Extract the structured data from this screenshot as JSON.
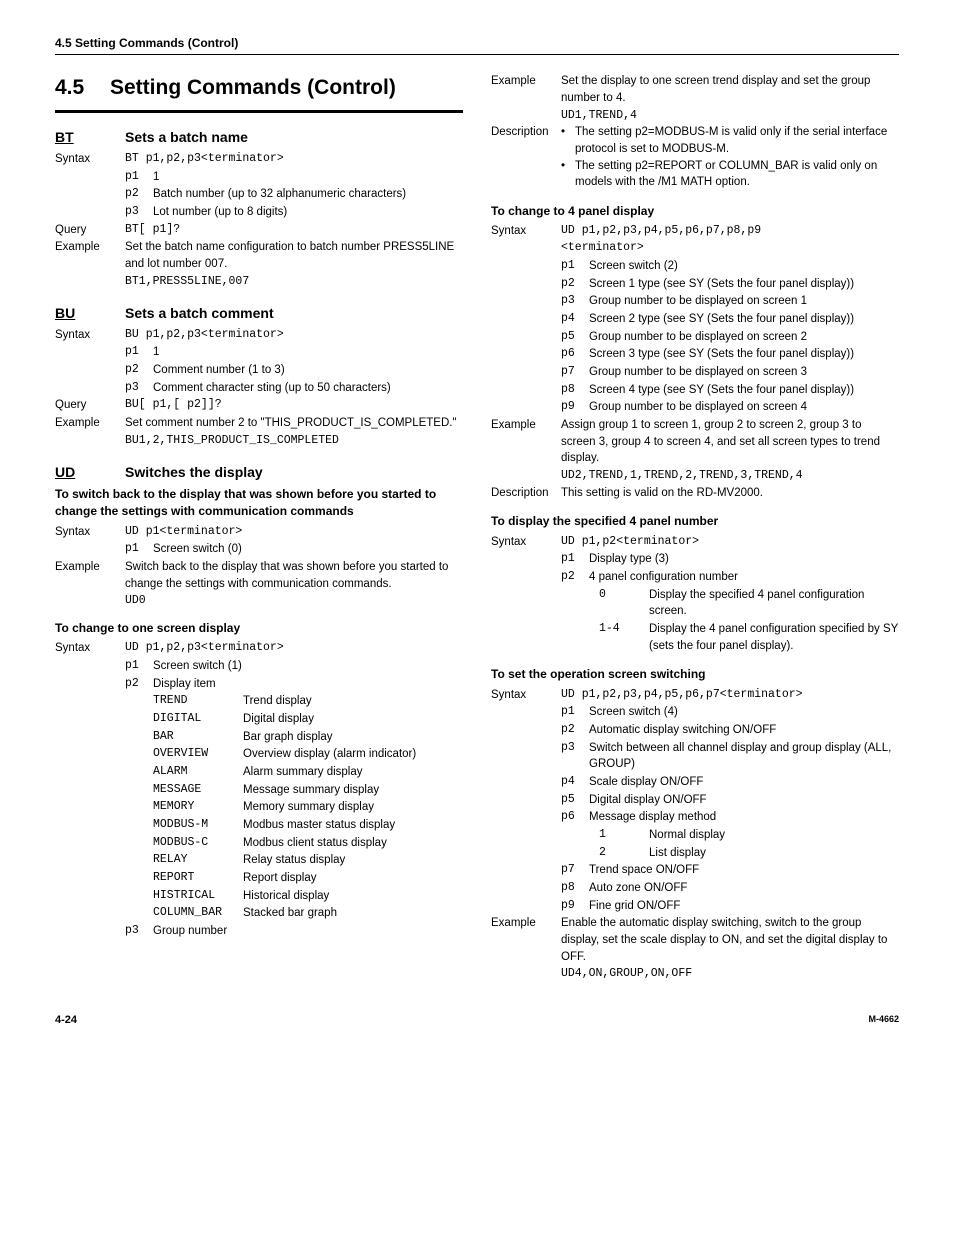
{
  "header": "4.5  Setting Commands (Control)",
  "section_number": "4.5",
  "section_title": "Setting Commands (Control)",
  "bt": {
    "code": "BT",
    "title": "Sets a batch name",
    "syntax_label": "Syntax",
    "syntax": "BT p1,p2,p3<terminator>",
    "p1": "1",
    "p2": "Batch number (up to 32 alphanumeric characters)",
    "p3": "Lot number (up to 8 digits)",
    "query_label": "Query",
    "query": "BT[ p1]?",
    "example_label": "Example",
    "example_text": "Set the batch name configuration to batch number PRESS5LINE and lot number 007.",
    "example_code": "BT1,PRESS5LINE,007"
  },
  "bu": {
    "code": "BU",
    "title": "Sets a batch comment",
    "syntax_label": "Syntax",
    "syntax": "BU p1,p2,p3<terminator>",
    "p1": "1",
    "p2": "Comment number (1 to 3)",
    "p3": "Comment character sting (up to 50 characters)",
    "query_label": "Query",
    "query": "BU[ p1,[ p2]]?",
    "example_label": "Example",
    "example_text": "Set comment number 2 to \"THIS_PRODUCT_IS_COMPLETED.\"",
    "example_code": "BU1,2,THIS_PRODUCT_IS_COMPLETED"
  },
  "ud": {
    "code": "UD",
    "title": "Switches the display",
    "sub1_head": "To switch back to the display that was shown before you started to change the settings with communication commands",
    "sub1_syntax_label": "Syntax",
    "sub1_syntax": "UD p1<terminator>",
    "sub1_p1": "Screen switch (0)",
    "sub1_example_label": "Example",
    "sub1_example_text": "Switch back to the display that was shown before you started to change the settings with communication commands.",
    "sub1_example_code": "UD0",
    "sub2_head": "To change to one screen display",
    "sub2_syntax_label": "Syntax",
    "sub2_syntax": "UD p1,p2,p3<terminator>",
    "sub2_p1": "Screen switch (1)",
    "sub2_p2": "Display item",
    "display_items": [
      [
        "TREND",
        "Trend display"
      ],
      [
        "DIGITAL",
        "Digital display"
      ],
      [
        "BAR",
        "Bar graph display"
      ],
      [
        "OVERVIEW",
        "Overview display (alarm indicator)"
      ],
      [
        "ALARM",
        "Alarm summary display"
      ],
      [
        "MESSAGE",
        "Message summary display"
      ],
      [
        "MEMORY",
        "Memory summary display"
      ],
      [
        "MODBUS-M",
        "Modbus master status display"
      ],
      [
        "MODBUS-C",
        "Modbus client status display"
      ],
      [
        "RELAY",
        "Relay status display"
      ],
      [
        "REPORT",
        "Report display"
      ],
      [
        "HISTRICAL",
        "Historical display"
      ],
      [
        "COLUMN_BAR",
        "Stacked bar graph"
      ]
    ],
    "sub2_p3": "Group number"
  },
  "col2_top": {
    "example_label": "Example",
    "example_text": "Set the display to one screen trend display and set the group number to 4.",
    "example_code": "UD1,TREND,4",
    "desc_label": "Description",
    "desc_b1": "The setting p2=MODBUS-M is valid only if the serial interface protocol is set to MODBUS-M.",
    "desc_b2": "The setting p2=REPORT or COLUMN_BAR is valid only on models with the /M1 MATH option."
  },
  "four_panel": {
    "head": "To change to 4 panel display",
    "syntax_label": "Syntax",
    "syntax_l1": "UD p1,p2,p3,p4,p5,p6,p7,p8,p9",
    "syntax_l2": "<terminator>",
    "p1": "Screen switch (2)",
    "p2": "Screen 1 type (see SY (Sets the four panel display))",
    "p3": "Group number to be displayed on screen 1",
    "p4": "Screen 2 type (see SY (Sets the four panel display))",
    "p5": "Group number to be displayed on screen 2",
    "p6": "Screen 3 type (see SY (Sets the four panel display))",
    "p7": "Group number to be displayed on screen 3",
    "p8": "Screen 4 type (see SY (Sets the four panel display))",
    "p9": "Group number to be displayed on screen 4",
    "example_label": "Example",
    "example_text": "Assign group 1 to screen 1, group 2 to screen 2, group 3 to screen 3, group 4 to screen 4, and set all screen types to trend display.",
    "example_code": "UD2,TREND,1,TREND,2,TREND,3,TREND,4",
    "desc_label": "Description",
    "desc_text": "This setting is valid on the RD-MV2000."
  },
  "disp4num": {
    "head": "To display the specified 4 panel number",
    "syntax_label": "Syntax",
    "syntax": "UD p1,p2<terminator>",
    "p1": "Display type (3)",
    "p2": "4 panel configuration number",
    "v0_code": "0",
    "v0_desc": "Display the specified 4 panel configuration screen.",
    "v14_code": "1-4",
    "v14_desc": "Display the 4 panel configuration specified by SY (sets the four panel display)."
  },
  "opscreen": {
    "head": "To set the operation screen switching",
    "syntax_label": "Syntax",
    "syntax": "UD  p1,p2,p3,p4,p5,p6,p7<terminator>",
    "p1": "Screen switch (4)",
    "p2": "Automatic display switching ON/OFF",
    "p3": "Switch between all channel display and group display (ALL, GROUP)",
    "p4": "Scale display ON/OFF",
    "p5": "Digital display ON/OFF",
    "p6": "Message display method",
    "v1_code": "1",
    "v1_desc": "Normal display",
    "v2_code": "2",
    "v2_desc": "List display",
    "p7": "Trend space ON/OFF",
    "p8": "Auto zone ON/OFF",
    "p9": "Fine grid ON/OFF",
    "example_label": "Example",
    "example_text": "Enable the automatic display switching, switch to the group display, set the scale display to ON, and set the digital display to OFF.",
    "example_code": "UD4,ON,GROUP,ON,OFF"
  },
  "footer": {
    "page": "4-24",
    "manual": "M-4662"
  }
}
